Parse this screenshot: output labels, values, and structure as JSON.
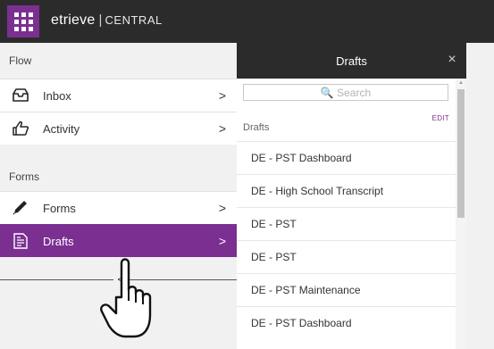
{
  "header": {
    "brand_logo": "etrieve",
    "brand_separator": "|",
    "brand_product": "CENTRAL"
  },
  "nav": {
    "flow_section": "Flow",
    "flow_items": [
      {
        "label": "Inbox",
        "icon": "inbox-icon"
      },
      {
        "label": "Activity",
        "icon": "thumbs-up-icon"
      }
    ],
    "forms_section": "Forms",
    "forms_items": [
      {
        "label": "Forms",
        "icon": "pencil-icon"
      },
      {
        "label": "Drafts",
        "icon": "drafts-document-icon",
        "active": true
      }
    ],
    "chevron": ">",
    "collapse": "<"
  },
  "drafts_panel": {
    "title": "Drafts",
    "close": "×",
    "search_placeholder": "🔍 Search",
    "subheader": "Drafts",
    "edit_label": "EDIT",
    "items": [
      "DE - PST Dashboard",
      "DE - High School Transcript",
      "DE - PST",
      "DE - PST",
      "DE - PST Maintenance",
      "DE - PST Dashboard"
    ]
  },
  "colors": {
    "accent": "#7b2f91",
    "header_bg": "#2b2b2b",
    "panel_bg": "#f1f1f1"
  }
}
